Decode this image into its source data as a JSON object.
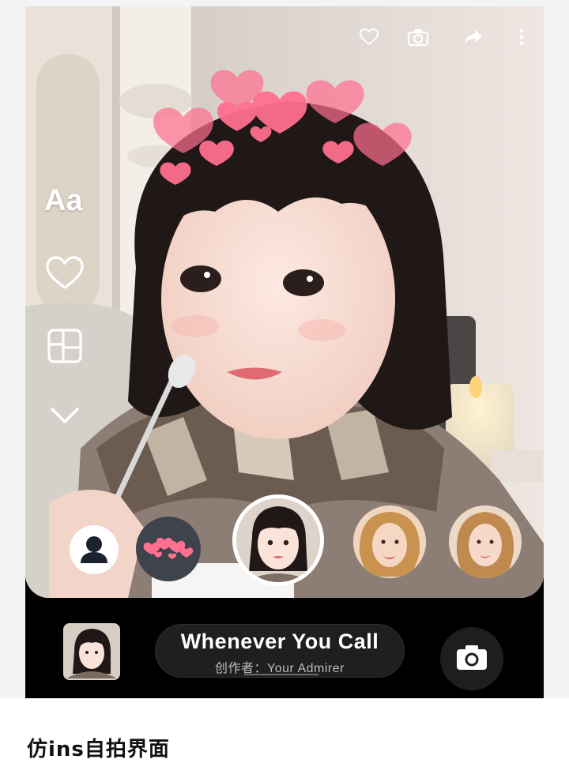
{
  "top_bar": {
    "icons": [
      "heart-outline-icon",
      "camera-icon",
      "share-arrow-icon",
      "more-vertical-icon"
    ]
  },
  "side_bar": {
    "text_tool_label": "Aa",
    "icons": [
      "heart-outline-icon",
      "layout-grid-icon",
      "chevron-down-icon"
    ]
  },
  "filters": {
    "items": [
      "profile-silhouette-icon",
      "hearts-filter",
      "selfie-filter-selected",
      "celebrity-face-filter-1",
      "celebrity-face-filter-2"
    ]
  },
  "music": {
    "title": "Whenever You Call",
    "creator": "创作者：Your Admirer"
  },
  "bottom_bar": {
    "shutter_icon": "camera-icon"
  },
  "caption": "仿ins自拍界面",
  "colors": {
    "accent_heart": "#ff5f86",
    "bar_background": "#000000",
    "pill_background": "#1f1f1f"
  }
}
